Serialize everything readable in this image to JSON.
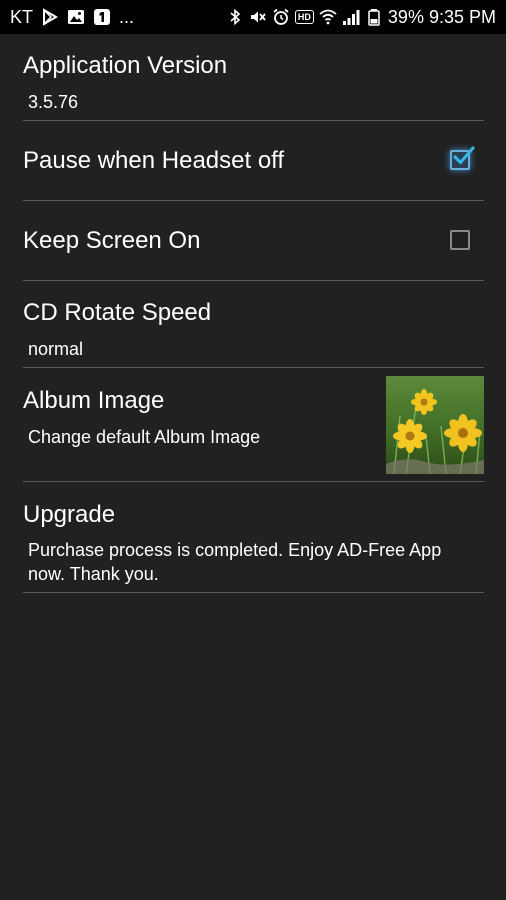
{
  "status_bar": {
    "carrier": "KT",
    "overflow": "...",
    "left_icons": [
      "play-store-icon",
      "gallery-icon",
      "notification-one-icon"
    ],
    "right_icons": [
      "bluetooth-icon",
      "mute-icon",
      "alarm-icon",
      "hd-icon",
      "wifi-icon",
      "signal-icon",
      "battery-icon"
    ],
    "hd_label": "HD",
    "battery": "39%",
    "time": "9:35 PM"
  },
  "preferences": [
    {
      "title": "Application Version",
      "summary": "3.5.76"
    },
    {
      "title": "Pause when Headset off",
      "checked": true
    },
    {
      "title": "Keep Screen On",
      "checked": false
    },
    {
      "title": "CD Rotate Speed",
      "summary": "normal"
    },
    {
      "title": "Album Image",
      "summary": "Change default Album Image",
      "image": "yellow-flowers-thumbnail"
    },
    {
      "title": "Upgrade",
      "summary": "Purchase process is completed. Enjoy AD-Free App now. Thank you."
    }
  ],
  "colors": {
    "background": "#212121",
    "status_bar": "#000000",
    "divider": "#5a5a5a",
    "accent": "#33b5e5",
    "text": "#ffffff"
  }
}
